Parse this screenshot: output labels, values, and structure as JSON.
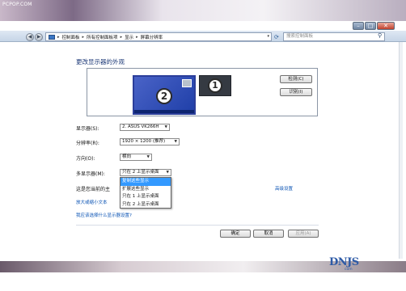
{
  "watermark_top": "PCPOP.COM",
  "window_controls": {
    "minimize": "–",
    "maximize": "□",
    "close": "✕"
  },
  "nav": {
    "back": "◀",
    "forward": "▶"
  },
  "breadcrumb": [
    "控制面板",
    "所有控制面板项",
    "显示",
    "屏幕分辨率"
  ],
  "address_dropdown": "▾",
  "search": {
    "placeholder": "搜索控制面板"
  },
  "page": {
    "title": "更改显示器的外观"
  },
  "monitors": [
    {
      "number": "2",
      "selected": true
    },
    {
      "number": "1",
      "selected": false
    }
  ],
  "buttons": {
    "detect": "检测(C)",
    "identify": "识别(I)",
    "ok": "确定",
    "cancel": "取消",
    "apply": "应用(A)"
  },
  "fields": {
    "display": {
      "label": "显示器(S):",
      "value": "2. ASUS VK266H"
    },
    "resolution": {
      "label": "分辨率(R):",
      "value": "1920 × 1200 (推荐)"
    },
    "orientation": {
      "label": "方向(O):",
      "value": "横向"
    },
    "multi_display": {
      "label": "多显示器(M):",
      "value": "只在 2 上显示桌面"
    }
  },
  "dropdown_options": [
    {
      "label": "复制这些显示",
      "selected": true
    },
    {
      "label": "扩展这些显示",
      "selected": false
    },
    {
      "label": "只在 1 上显示桌面",
      "selected": false
    },
    {
      "label": "只在 2 上显示桌面",
      "selected": false
    }
  ],
  "rows": {
    "primary_partial": "这是您当前的主",
    "text_size_partial": "放大或缩小文本",
    "advanced_link": "高级设置",
    "help_link": "我应该选择什么显示器设置?"
  },
  "logo": {
    "text": "DNJS",
    "sub": "com"
  },
  "colors": {
    "accent": "#1e3a78",
    "selection": "#3399ff",
    "monitor_active": "#2b3e9a"
  }
}
